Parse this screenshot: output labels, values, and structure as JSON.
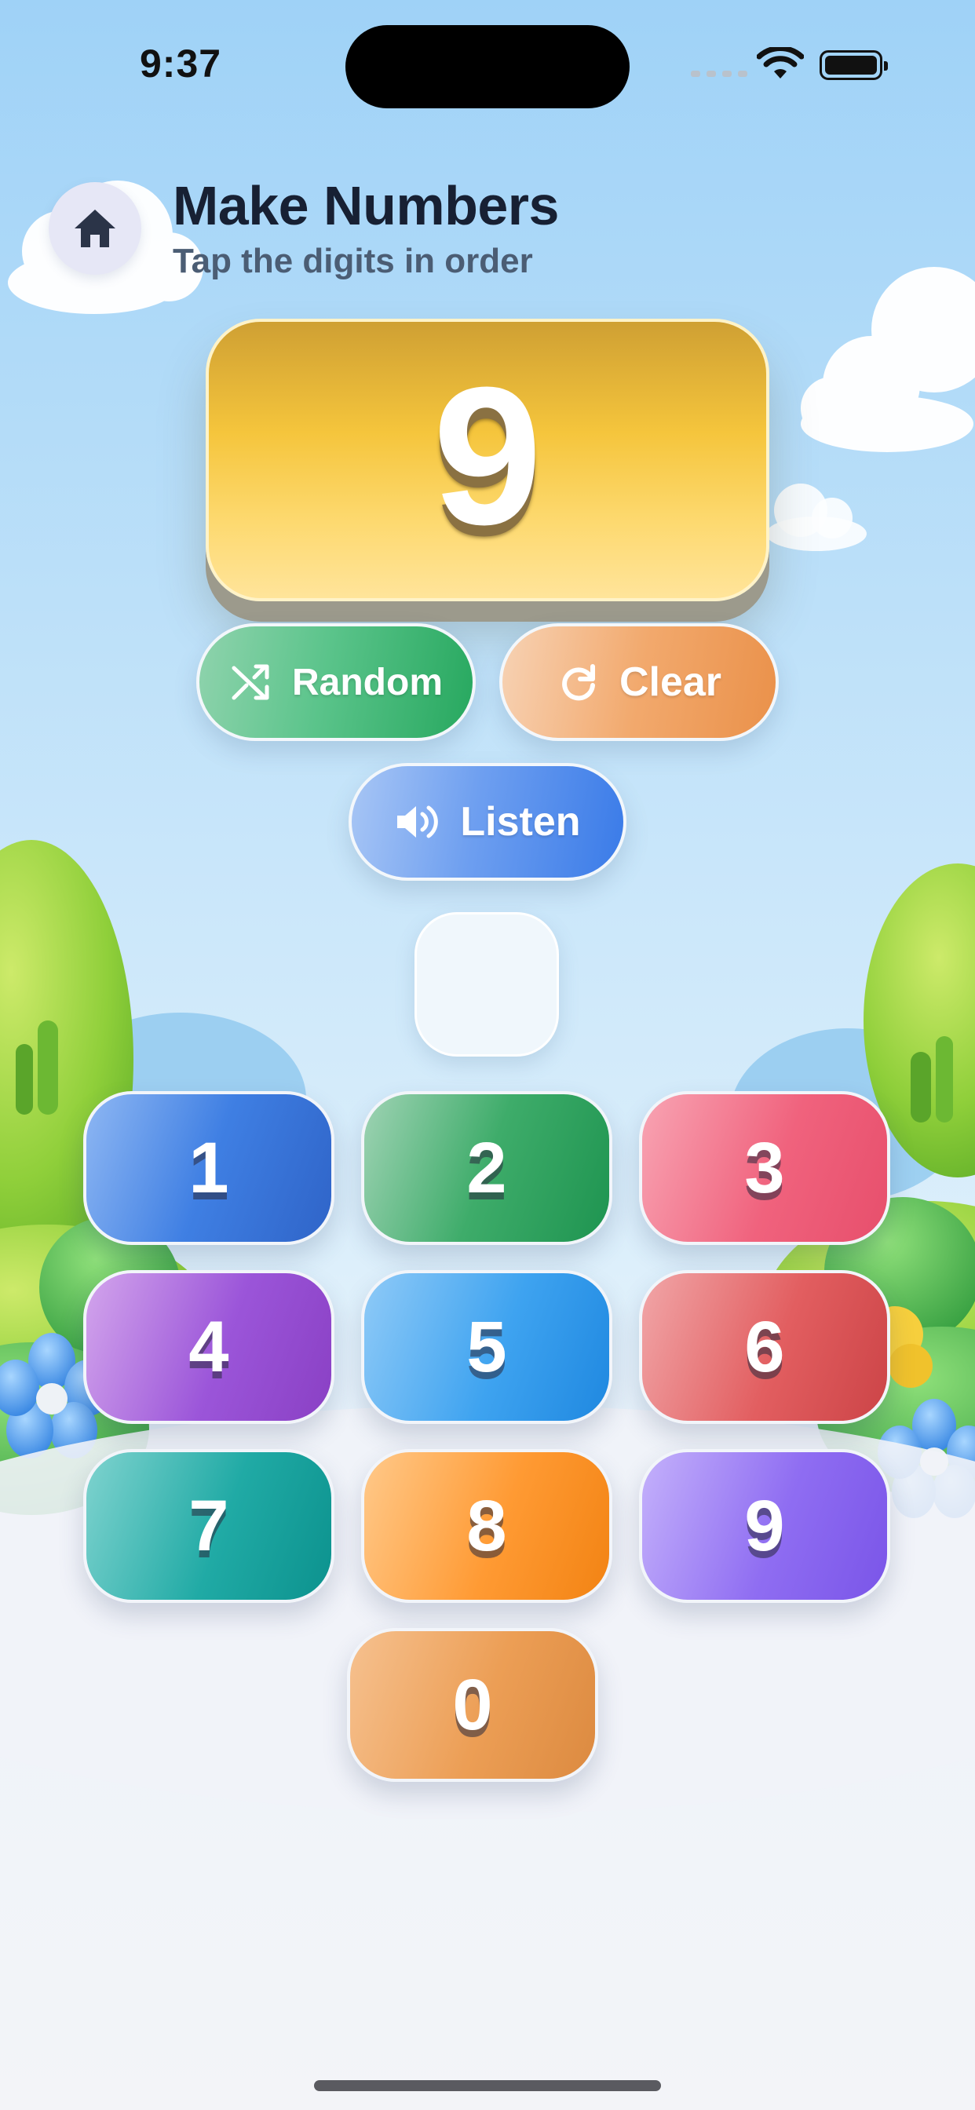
{
  "status_bar": {
    "time": "9:37"
  },
  "header": {
    "home_icon": "home-icon",
    "title": "Make Numbers",
    "subtitle": "Tap the digits in order"
  },
  "display": {
    "value": "9"
  },
  "actions": {
    "random": {
      "label": "Random",
      "icon": "shuffle-icon"
    },
    "clear": {
      "label": "Clear",
      "icon": "refresh-icon"
    },
    "listen": {
      "label": "Listen",
      "icon": "speaker-icon"
    }
  },
  "answer_slot": {
    "value": ""
  },
  "keypad": {
    "keys": [
      "1",
      "2",
      "3",
      "4",
      "5",
      "6",
      "7",
      "8",
      "9",
      "0"
    ]
  },
  "colors": {
    "display_gold": "#f5c53c",
    "random_green": "#5bc48b",
    "clear_orange": "#f2a96d",
    "listen_blue": "#6e9ff0"
  }
}
